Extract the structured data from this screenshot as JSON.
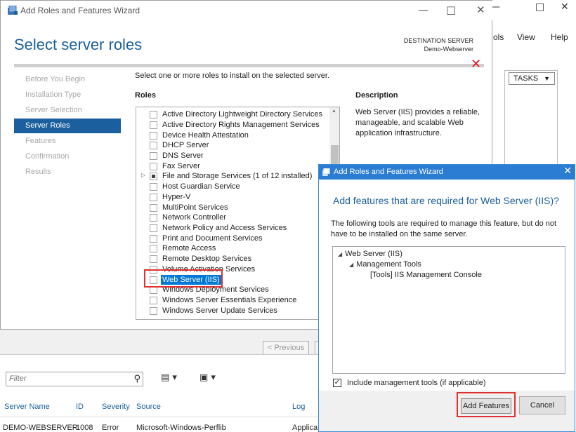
{
  "background_window": {
    "menu": [
      "ols",
      "View",
      "Help"
    ],
    "tasks_label": "TASKS"
  },
  "wizard": {
    "window_title": "Add Roles and Features Wizard",
    "page_title": "Select server roles",
    "destination_label": "DESTINATION SERVER",
    "destination_server": "Demo-Webserver",
    "nav": [
      {
        "label": "Before You Begin",
        "active": false
      },
      {
        "label": "Installation Type",
        "active": false
      },
      {
        "label": "Server Selection",
        "active": false
      },
      {
        "label": "Server Roles",
        "active": true
      },
      {
        "label": "Features",
        "active": false
      },
      {
        "label": "Confirmation",
        "active": false
      },
      {
        "label": "Results",
        "active": false
      }
    ],
    "instruction": "Select one or more roles to install on the selected server.",
    "roles_heading": "Roles",
    "roles": [
      "Active Directory Lightweight Directory Services",
      "Active Directory Rights Management Services",
      "Device Health Attestation",
      "DHCP Server",
      "DNS Server",
      "Fax Server",
      "File and Storage Services (1 of 12 installed)",
      "Host Guardian Service",
      "Hyper-V",
      "MultiPoint Services",
      "Network Controller",
      "Network Policy and Access Services",
      "Print and Document Services",
      "Remote Access",
      "Remote Desktop Services",
      "Volume Activation Services",
      "Web Server (IIS)",
      "Windows Deployment Services",
      "Windows Server Essentials Experience",
      "Windows Server Update Services"
    ],
    "description_heading": "Description",
    "description_text": "Web Server (IIS) provides a reliable, manageable, and scalable Web application infrastructure.",
    "prev_button": "< Previous"
  },
  "events": {
    "filter_placeholder": "Filter",
    "columns": [
      "Server Name",
      "ID",
      "Severity",
      "Source",
      "Log"
    ],
    "row": [
      "DEMO-WEBSERVER",
      "1008",
      "Error",
      "Microsoft-Windows-Perflib",
      "Applica"
    ]
  },
  "dialog": {
    "title": "Add Roles and Features Wizard",
    "heading": "Add features that are required for Web Server (IIS)?",
    "text": "The following tools are required to manage this feature, but do not have to be installed on the same server.",
    "tree": [
      "Web Server (IIS)",
      "Management Tools",
      "[Tools] IIS Management Console"
    ],
    "include_label": "Include management tools (if applicable)",
    "include_checked": true,
    "add_button": "Add Features",
    "cancel_button": "Cancel"
  },
  "colors": {
    "accent_blue": "#1b5f9e",
    "dialog_title_blue": "#2b7dd3",
    "selection_blue": "#0078d7",
    "highlight_red": "#e03030"
  }
}
